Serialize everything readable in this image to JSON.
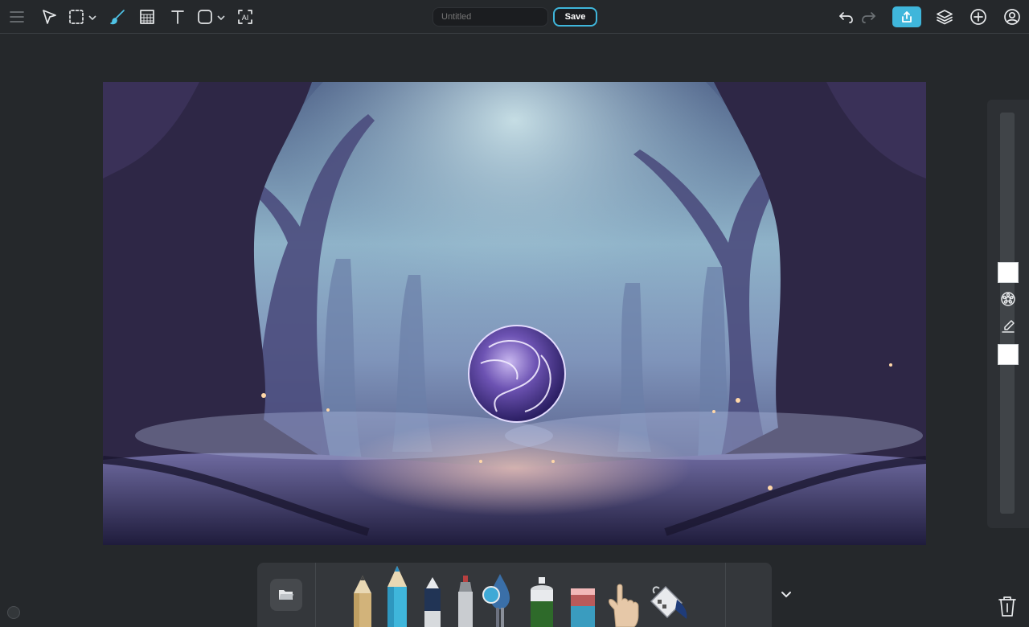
{
  "document": {
    "title_placeholder": "Untitled",
    "title_value": "",
    "save_label": "Save"
  },
  "toolbar_left": [
    {
      "name": "menu-icon",
      "state": "dim"
    },
    {
      "name": "select-arrow-icon",
      "state": "normal"
    },
    {
      "name": "marquee-select-icon",
      "state": "normal",
      "has_dropdown": true
    },
    {
      "name": "brush-icon",
      "state": "active"
    },
    {
      "name": "fill-pattern-icon",
      "state": "normal"
    },
    {
      "name": "text-icon",
      "state": "normal"
    },
    {
      "name": "shape-icon",
      "state": "normal",
      "has_dropdown": true
    },
    {
      "name": "ai-icon",
      "state": "normal"
    }
  ],
  "ai_label": "AI",
  "toolbar_right": [
    {
      "name": "undo-icon",
      "enabled": true
    },
    {
      "name": "redo-icon",
      "enabled": false
    },
    {
      "name": "share-icon"
    },
    {
      "name": "layers-icon"
    },
    {
      "name": "add-icon"
    },
    {
      "name": "account-icon"
    }
  ],
  "canvas": {
    "content": "fantasy-forest-with-glowing-orb"
  },
  "right_panel": {
    "primary_swatch_color": "#ffffff",
    "secondary_swatch_color": "#ffffff",
    "icons": [
      "color-wheel-icon",
      "eraser-pen-icon"
    ]
  },
  "tray": {
    "tools": [
      {
        "name": "pencil-tool"
      },
      {
        "name": "blue-pencil-tool",
        "selected": true
      },
      {
        "name": "marker-tool"
      },
      {
        "name": "fine-pen-tool"
      },
      {
        "name": "ink-drop-tool"
      },
      {
        "name": "spray-can-tool"
      },
      {
        "name": "eraser-tool"
      },
      {
        "name": "hand-tool"
      },
      {
        "name": "paint-bucket-tool"
      }
    ],
    "active_color": "#3fa9d6"
  },
  "colors": {
    "accent": "#3fb6db",
    "background": "#25282b",
    "panel": "#2d3034"
  }
}
